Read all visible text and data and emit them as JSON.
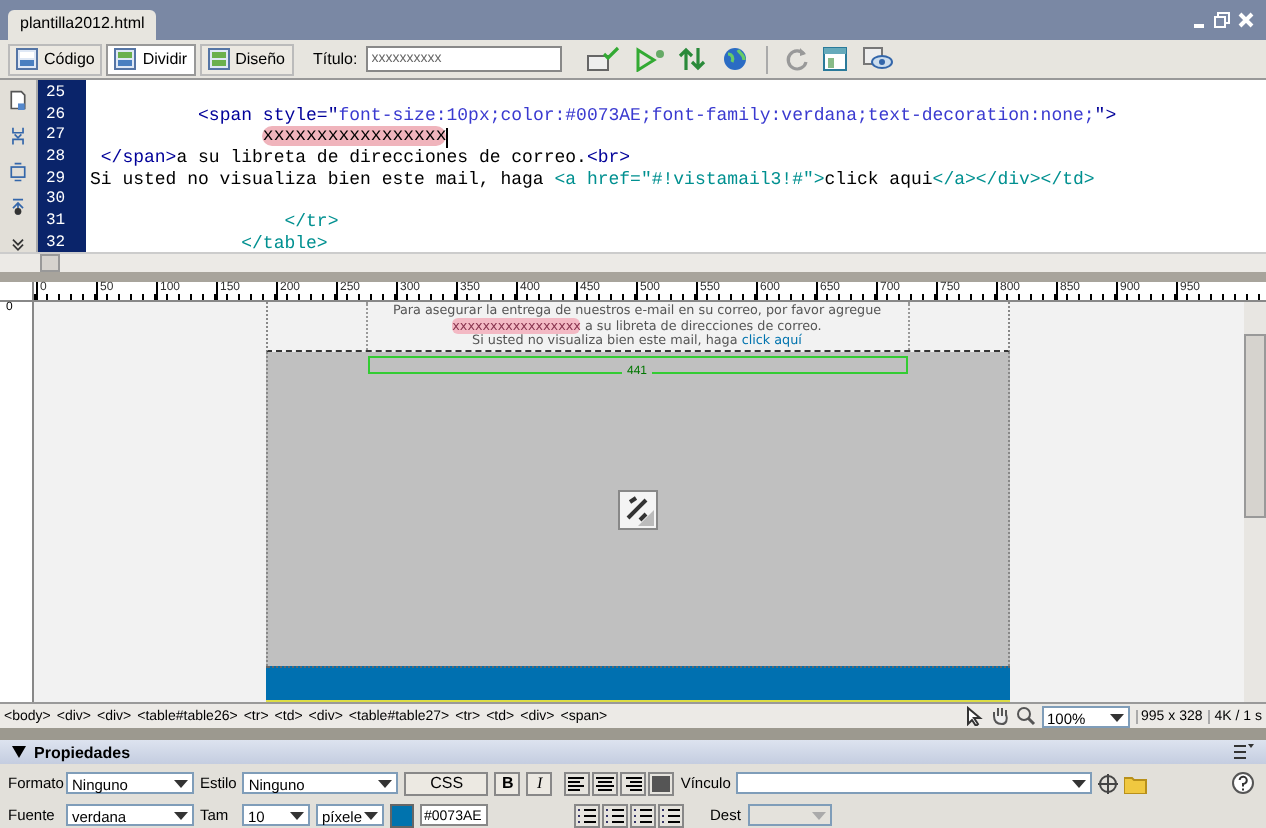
{
  "document_tab": {
    "label": "plantilla2012.html"
  },
  "view_buttons": [
    {
      "label": "Código",
      "selected": false
    },
    {
      "label": "Dividir",
      "selected": true
    },
    {
      "label": "Diseño",
      "selected": false
    }
  ],
  "title_field": {
    "label": "Título:",
    "value": "xxxxxxxxxx"
  },
  "code_lines": [
    {
      "number": "25",
      "cursor": false
    },
    {
      "number": "26",
      "cursor": false,
      "segments": [
        {
          "kind": "markup",
          "text": "          <span style=\""
        },
        {
          "kind": "value",
          "text": "font-size:10px;color:#0073AE;font-family:verdana;text-decoration:none;"
        },
        {
          "kind": "markup",
          "text": "\">"
        }
      ]
    },
    {
      "number": "27",
      "cursor": true,
      "segments": [
        {
          "kind": "marked",
          "text": "                xxxxxxxxxxxxxxxxx"
        }
      ]
    },
    {
      "number": "28",
      "cursor": false,
      "segments": [
        {
          "kind": "markup",
          "text": " </span>"
        },
        {
          "kind": "text",
          "text": "a su libreta de direcciones de correo."
        },
        {
          "kind": "markup",
          "text": "<br>"
        }
      ]
    },
    {
      "number": "29",
      "cursor": false,
      "segments": [
        {
          "kind": "text",
          "text": "Si usted no visualiza bien este mail, haga "
        },
        {
          "kind": "closing",
          "text": "<a href=\"#!vistamail3!#\">"
        },
        {
          "kind": "text",
          "text": "click aqui"
        },
        {
          "kind": "closing",
          "text": "</a></div></td>"
        }
      ]
    },
    {
      "number": "30",
      "cursor": false
    },
    {
      "number": "31",
      "cursor": false,
      "segments": [
        {
          "kind": "closing",
          "text": "                  </tr>"
        }
      ]
    },
    {
      "number": "32",
      "cursor": false,
      "segments": [
        {
          "kind": "closing",
          "text": "              </table>"
        }
      ]
    }
  ],
  "ruler_labels": [
    "0",
    "50",
    "100",
    "150",
    "200",
    "250",
    "300",
    "350",
    "400",
    "450",
    "500",
    "550",
    "600",
    "650",
    "700",
    "750",
    "800",
    "850",
    "900",
    "950"
  ],
  "vertical_ruler_label": "0",
  "design_lines": [
    [
      {
        "kind": "text",
        "text": "Para asegurar la entrega de nuestros e-mail en su correo, por favor agregue"
      }
    ],
    [
      {
        "kind": "marked",
        "text": "xxxxxxxxxxxxxxxxx"
      },
      {
        "kind": "text",
        "text": " a su libreta de direcciones de correo."
      }
    ],
    [
      {
        "kind": "text",
        "text": "Si usted no visualiza bien este mail, haga "
      },
      {
        "kind": "link",
        "text": "click aquí"
      }
    ]
  ],
  "width_indicator": "441",
  "status_bar": {
    "tags": [
      "<body>",
      "<div>",
      "<div>",
      "<table#table26>",
      "<tr>",
      "<td>",
      "<div>",
      "<table#table27>",
      "<tr>",
      "<td>",
      "<div>",
      "<span>"
    ],
    "zoom": "100%",
    "window_size": "995 x 328",
    "download": "4K / 1 s"
  },
  "properties": {
    "title": "Propiedades",
    "expanded": true,
    "format": {
      "label": "Formato",
      "value": "Ninguno"
    },
    "style": {
      "label": "Estilo",
      "value": "Ninguno"
    },
    "css_button": "CSS",
    "bold_button": "B",
    "italic_button": "I",
    "link": {
      "label": "Vínculo"
    },
    "font": {
      "label": "Fuente",
      "value": "verdana"
    },
    "size": {
      "label": "Tam",
      "value": "10",
      "unit": "píxele"
    },
    "color": {
      "value": "#0073AE"
    },
    "target": {
      "label": "Dest",
      "disabled": true
    }
  }
}
